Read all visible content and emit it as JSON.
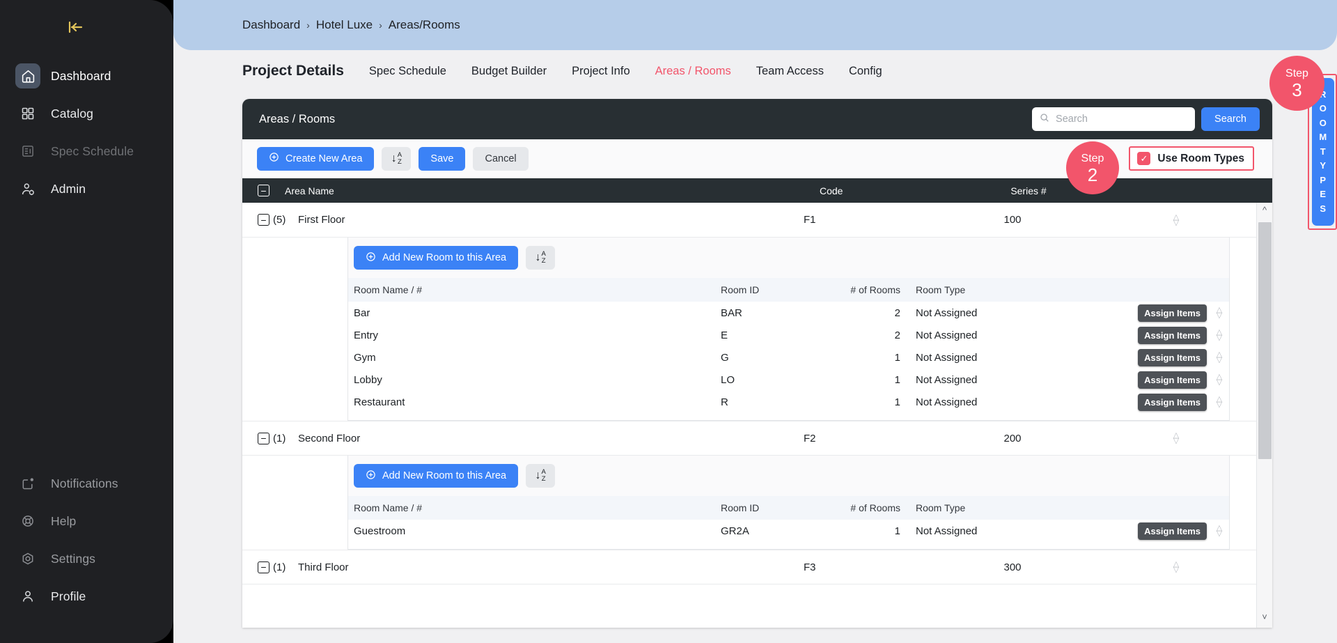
{
  "sidebar": {
    "collapse_icon": "collapse-panel-icon",
    "primary_items": [
      {
        "label": "Dashboard",
        "icon": "home-icon",
        "state": "active"
      },
      {
        "label": "Catalog",
        "icon": "grid-icon",
        "state": "bright"
      },
      {
        "label": "Spec Schedule",
        "icon": "document-list-icon",
        "state": "dimmer"
      },
      {
        "label": "Admin",
        "icon": "user-gear-icon",
        "state": "bright"
      }
    ],
    "secondary_items": [
      {
        "label": "Notifications",
        "icon": "bell-square-icon",
        "state": "dim"
      },
      {
        "label": "Help",
        "icon": "lifebuoy-icon",
        "state": "dim"
      },
      {
        "label": "Settings",
        "icon": "gear-hex-icon",
        "state": "dim"
      },
      {
        "label": "Profile",
        "icon": "user-icon",
        "state": "bright"
      }
    ]
  },
  "breadcrumb": {
    "items": [
      "Dashboard",
      "Hotel Luxe",
      "Areas/Rooms"
    ],
    "separator": "›"
  },
  "header": {
    "page_title": "Project Details",
    "tabs": [
      {
        "label": "Spec Schedule",
        "active": false
      },
      {
        "label": "Budget Builder",
        "active": false
      },
      {
        "label": "Project Info",
        "active": false
      },
      {
        "label": "Areas / Rooms",
        "active": true
      },
      {
        "label": "Team Access",
        "active": false
      },
      {
        "label": "Config",
        "active": false
      }
    ]
  },
  "panel": {
    "title": "Areas / Rooms",
    "search": {
      "placeholder": "Search",
      "value": "",
      "button_label": "Search"
    },
    "toolbar": {
      "create_area_label": "Create New Area",
      "sort_label": "A\nZ",
      "save_label": "Save",
      "cancel_label": "Cancel",
      "use_room_types_label": "Use Room Types",
      "use_room_types_checked": true,
      "checkmark": "✓"
    },
    "table_headers": {
      "area_name": "Area Name",
      "code": "Code",
      "series": "Series #"
    },
    "sub_table_headers": {
      "room_name": "Room Name / #",
      "room_id": "Room ID",
      "num_rooms": "# of Rooms",
      "room_type": "Room Type"
    },
    "add_room_label": "Add New Room to this Area",
    "assign_items_label": "Assign Items",
    "areas": [
      {
        "count": "(5)",
        "name": "First Floor",
        "code": "F1",
        "series": "100",
        "expanded": true,
        "rooms": [
          {
            "name": "Bar",
            "id": "BAR",
            "num": "2",
            "type": "Not Assigned"
          },
          {
            "name": "Entry",
            "id": "E",
            "num": "2",
            "type": "Not Assigned"
          },
          {
            "name": "Gym",
            "id": "G",
            "num": "1",
            "type": "Not Assigned"
          },
          {
            "name": "Lobby",
            "id": "LO",
            "num": "1",
            "type": "Not Assigned"
          },
          {
            "name": "Restaurant",
            "id": "R",
            "num": "1",
            "type": "Not Assigned"
          }
        ]
      },
      {
        "count": "(1)",
        "name": "Second Floor",
        "code": "F2",
        "series": "200",
        "expanded": true,
        "rooms": [
          {
            "name": "Guestroom",
            "id": "GR2A",
            "num": "1",
            "type": "Not Assigned"
          }
        ]
      },
      {
        "count": "(1)",
        "name": "Third Floor",
        "code": "F3",
        "series": "300",
        "expanded": true,
        "rooms": []
      }
    ]
  },
  "room_types_tab": {
    "label": "ROOM TYPES",
    "letters": [
      "R",
      "O",
      "O",
      "M",
      "T",
      "Y",
      "P",
      "E",
      "S"
    ]
  },
  "annotations": [
    {
      "word": "Step",
      "number": "2",
      "target": "use-room-types-checkbox"
    },
    {
      "word": "Step",
      "number": "3",
      "target": "room-types-tab"
    }
  ],
  "colors": {
    "accent_blue": "#3b82f6",
    "annotation_red": "#f2556b",
    "sidebar_bg": "#1f2023",
    "breadcrumb_bg": "#b6cde9",
    "panel_header_bg": "#282f33",
    "assign_btn_bg": "#4e5257"
  }
}
